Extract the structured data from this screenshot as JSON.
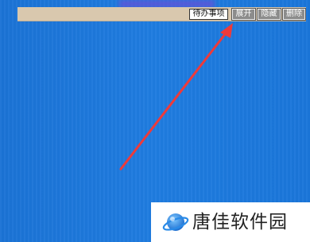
{
  "toolbar": {
    "todo_label": "待办事项",
    "expand_label": "展开",
    "hide_label": "隐藏",
    "delete_label": "删除"
  },
  "annotation": {
    "arrow_color": "#ee3a3a"
  },
  "watermark": {
    "text": "唐佳软件园",
    "logo_icon": "planet-logo-icon"
  },
  "colors": {
    "desktop_blue": "#1f7ce0",
    "toolbar_bg": "#d9c8ae",
    "button_dark": "#8c8c8c"
  }
}
